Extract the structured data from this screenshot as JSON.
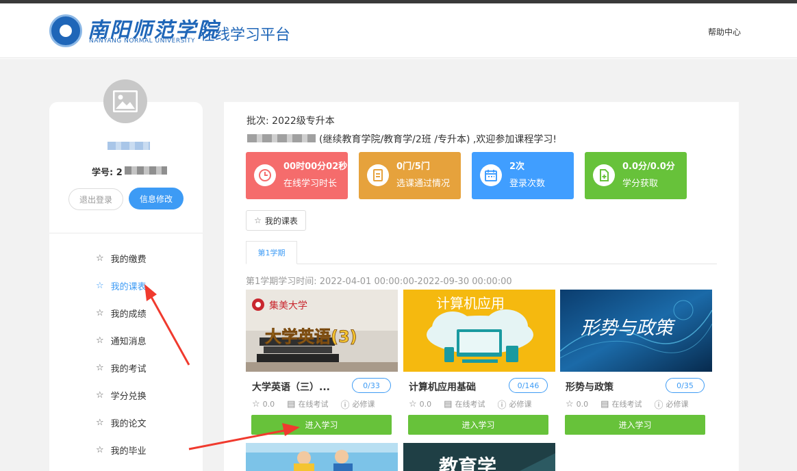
{
  "header": {
    "logo_cn": "南阳师范学院",
    "logo_en": "NANYANG NORMAL UNIVERSITY",
    "platform_title": "在线学习平台",
    "help_link": "帮助中心"
  },
  "profile": {
    "student_id_label": "学号: 2",
    "logout_label": "退出登录",
    "edit_label": "信息修改"
  },
  "menu": [
    {
      "label": "我的缴费",
      "active": false
    },
    {
      "label": "我的课表",
      "active": true
    },
    {
      "label": "我的成绩",
      "active": false
    },
    {
      "label": "通知消息",
      "active": false
    },
    {
      "label": "我的考试",
      "active": false
    },
    {
      "label": "学分兑换",
      "active": false
    },
    {
      "label": "我的论文",
      "active": false
    },
    {
      "label": "我的毕业",
      "active": false
    }
  ],
  "main": {
    "batch": "批次: 2022级专升本",
    "welcome": "(继续教育学院/教育学/2班 /专升本) ,欢迎参加课程学习!",
    "my_courses_label": "我的课表",
    "tab_label": "第1学期",
    "semester_time": "第1学期学习时间: 2022-04-01 00:00:00-2022-09-30 00:00:00"
  },
  "stats": [
    {
      "value": "00时00分02秒",
      "label": "在线学习时长",
      "color": "#f56c6c",
      "icon": "clock-icon"
    },
    {
      "value": "0门/5门",
      "label": "选课通过情况",
      "color": "#e6a23c",
      "icon": "document-icon"
    },
    {
      "value": "2次",
      "label": "登录次数",
      "color": "#409eff",
      "icon": "calendar-icon"
    },
    {
      "value": "0.0分/0.0分",
      "label": "学分获取",
      "color": "#67c23a",
      "icon": "file-plus-icon"
    }
  ],
  "courses": [
    {
      "title": "大学英语（三）...",
      "count": "0/33",
      "rating": "0.0",
      "exam": "在线考试",
      "type": "必修课",
      "enter": "进入学习",
      "image_text": "大学英语(3)",
      "image_brand": "集美大学"
    },
    {
      "title": "计算机应用基础",
      "count": "0/146",
      "rating": "0.0",
      "exam": "在线考试",
      "type": "必修课",
      "enter": "进入学习",
      "image_text": "计算机应用"
    },
    {
      "title": "形势与政策",
      "count": "0/35",
      "rating": "0.0",
      "exam": "在线考试",
      "type": "必修课",
      "enter": "进入学习",
      "image_text": "形势与政策"
    }
  ],
  "more_courses": [
    {
      "image_text": ""
    },
    {
      "image_text": "教育学"
    }
  ]
}
